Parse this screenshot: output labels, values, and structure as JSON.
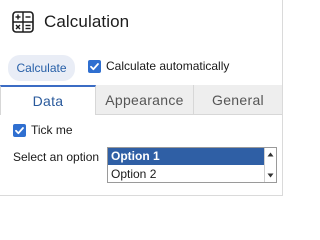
{
  "header": {
    "title": "Calculation",
    "icon": "calculator-icon"
  },
  "toolbar": {
    "calculate_label": "Calculate",
    "auto_label": "Calculate automatically",
    "auto_checked": true
  },
  "tabs": [
    {
      "label": "Data",
      "active": true
    },
    {
      "label": "Appearance",
      "active": false
    },
    {
      "label": "General",
      "active": false
    }
  ],
  "data_tab": {
    "tick_label": "Tick me",
    "tick_checked": true,
    "select_label": "Select an option",
    "options": [
      "Option 1",
      "Option 2"
    ],
    "selected_option": "Option 1"
  },
  "colors": {
    "accent": "#2f6fd0",
    "selected_row": "#2f5fa5",
    "button_bg": "#e9edf6",
    "button_text": "#2860a8",
    "inactive_tab_bg": "#eeeeee"
  }
}
